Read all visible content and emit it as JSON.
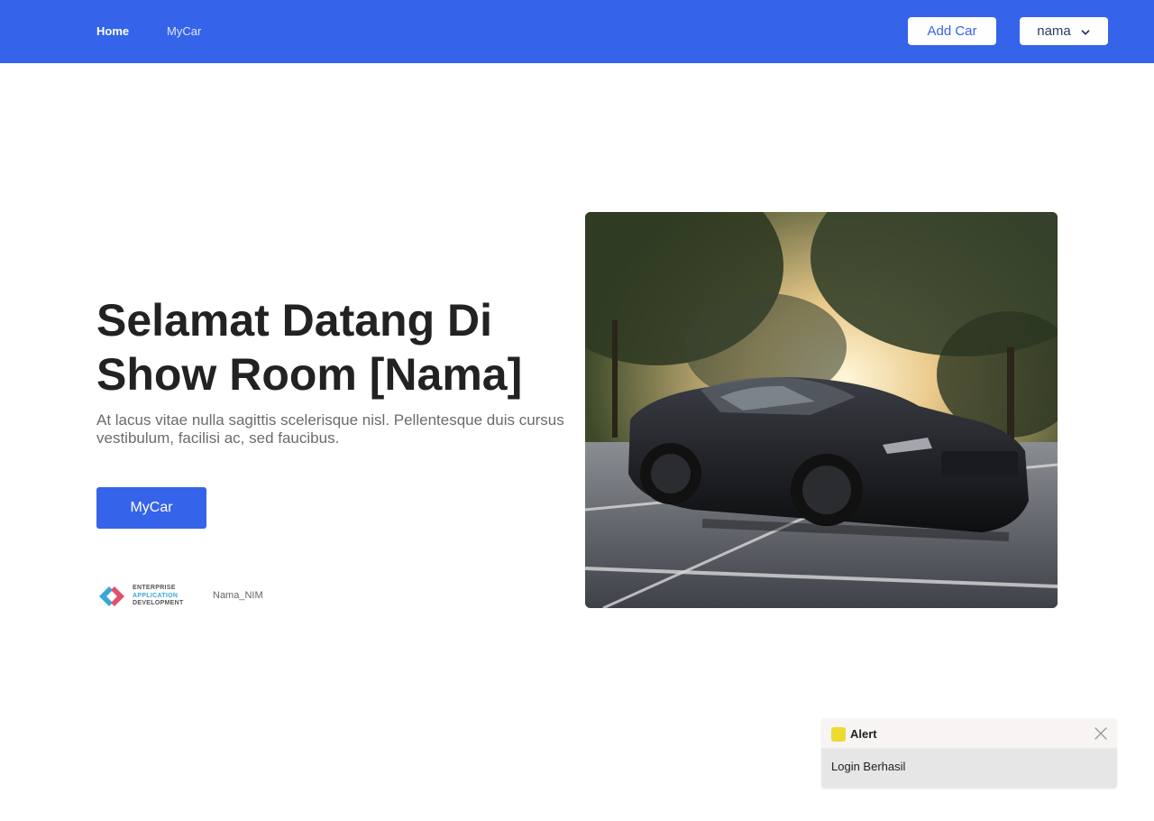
{
  "navbar": {
    "home_label": "Home",
    "mycar_label": "MyCar",
    "add_car_label": "Add Car",
    "user_label": "nama",
    "background": "#3563e9"
  },
  "hero": {
    "title": "Selamat Datang Di Show Room [Nama]",
    "description": "At lacus vitae nulla sagittis scelerisque nisl. Pellentesque duis cursus vestibulum, facilisi ac, sed faucibus.",
    "cta_label": "MyCar"
  },
  "footer": {
    "logo_line1": "ENTERPRISE",
    "logo_line2": "APPLICATION",
    "logo_line3": "DEVELOPMENT",
    "nim_label": "Nama_NIM"
  },
  "alert": {
    "title": "Alert",
    "message": "Login Berhasil",
    "indicator_color": "#eadb30"
  },
  "icons": {
    "user_menu": "chevron-down-icon",
    "alert_close": "close-icon",
    "logo": "code-brackets-icon"
  },
  "colors": {
    "accent": "#3563e9",
    "text_dark": "#222222",
    "text_muted": "#6b6b6b"
  }
}
